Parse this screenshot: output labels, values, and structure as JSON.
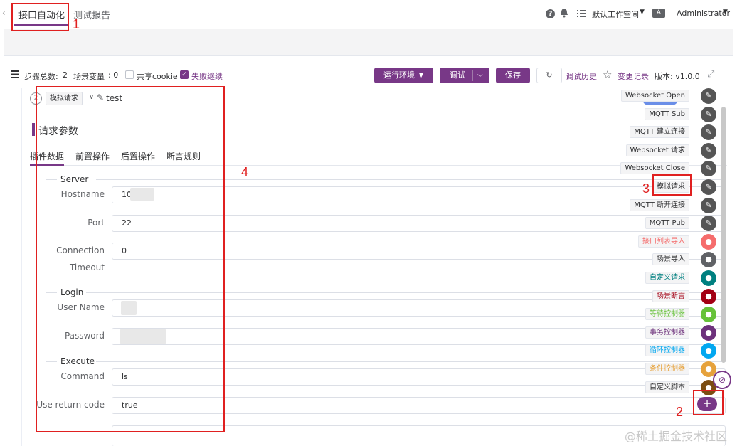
{
  "header": {
    "tabs": [
      "接口自动化",
      "测试报告"
    ],
    "help_icon": "question-icon",
    "bell_icon": "bell-icon",
    "workspace": "默认工作空间",
    "lang_badge": "A",
    "user": "Administrator"
  },
  "toolbar": {
    "step_total_label": "步骤总数:",
    "step_total_value": "2",
    "scene_var_label": "场景变量",
    "scene_var_value": ": 0",
    "share_cookie": "共享cookie",
    "fail_continue": "失败继续",
    "run_env": "运行环境",
    "debug": "调试",
    "save": "保存",
    "debug_history": "调试历史",
    "change_record": "变更记录",
    "version": "版本: v1.0.0"
  },
  "step": {
    "index": "2",
    "type_tag": "模拟请求",
    "name": "test"
  },
  "params": {
    "title": "请求参数",
    "tabs": [
      "插件数据",
      "前置操作",
      "后置操作",
      "断言规则"
    ],
    "groups": [
      "Server",
      "Login",
      "Execute"
    ],
    "fields": [
      {
        "label": "Hostname",
        "value": "10"
      },
      {
        "label": "Port",
        "value": "22"
      },
      {
        "label": "Connection",
        "label2": "Timeout",
        "value": "0"
      },
      {
        "label": "User Name",
        "value": ""
      },
      {
        "label": "Password",
        "value": ""
      },
      {
        "label": "Command",
        "value": "ls"
      },
      {
        "label": "Use return code",
        "value": "true"
      }
    ]
  },
  "components": [
    {
      "label": "Websocket Open",
      "color": "#555555",
      "label_color": "#303133"
    },
    {
      "label": "MQTT Sub",
      "color": "#555555",
      "label_color": "#303133"
    },
    {
      "label": "MQTT 建立连接",
      "color": "#555555",
      "label_color": "#303133"
    },
    {
      "label": "Websocket 请求",
      "color": "#555555",
      "label_color": "#303133"
    },
    {
      "label": "Websocket Close",
      "color": "#555555",
      "label_color": "#303133"
    },
    {
      "label": "模拟请求",
      "color": "#555555",
      "label_color": "#303133"
    },
    {
      "label": "MQTT 断开连接",
      "color": "#555555",
      "label_color": "#303133"
    },
    {
      "label": "MQTT Pub",
      "color": "#555555",
      "label_color": "#303133"
    },
    {
      "label": "接口列表导入",
      "color": "#F56C6C",
      "label_color": "#F56C6C"
    },
    {
      "label": "场景导入",
      "color": "#606266",
      "label_color": "#303133"
    },
    {
      "label": "自定义请求",
      "color": "#008080",
      "label_color": "#008080"
    },
    {
      "label": "场景断言",
      "color": "#A30014",
      "label_color": "#A30014"
    },
    {
      "label": "等待控制器",
      "color": "#67C23A",
      "label_color": "#67C23A"
    },
    {
      "label": "事务控制器",
      "color": "#6D317C",
      "label_color": "#6D317C"
    },
    {
      "label": "循环控制器",
      "color": "#02A7F0",
      "label_color": "#02A7F0"
    },
    {
      "label": "条件控制器",
      "color": "#E6A23C",
      "label_color": "#E6A23C"
    },
    {
      "label": "自定义脚本",
      "color": "#7B4D12",
      "label_color": "#303133"
    }
  ],
  "annotations": [
    "1",
    "2",
    "3",
    "4"
  ],
  "watermark": "@稀土掘金技术社区"
}
